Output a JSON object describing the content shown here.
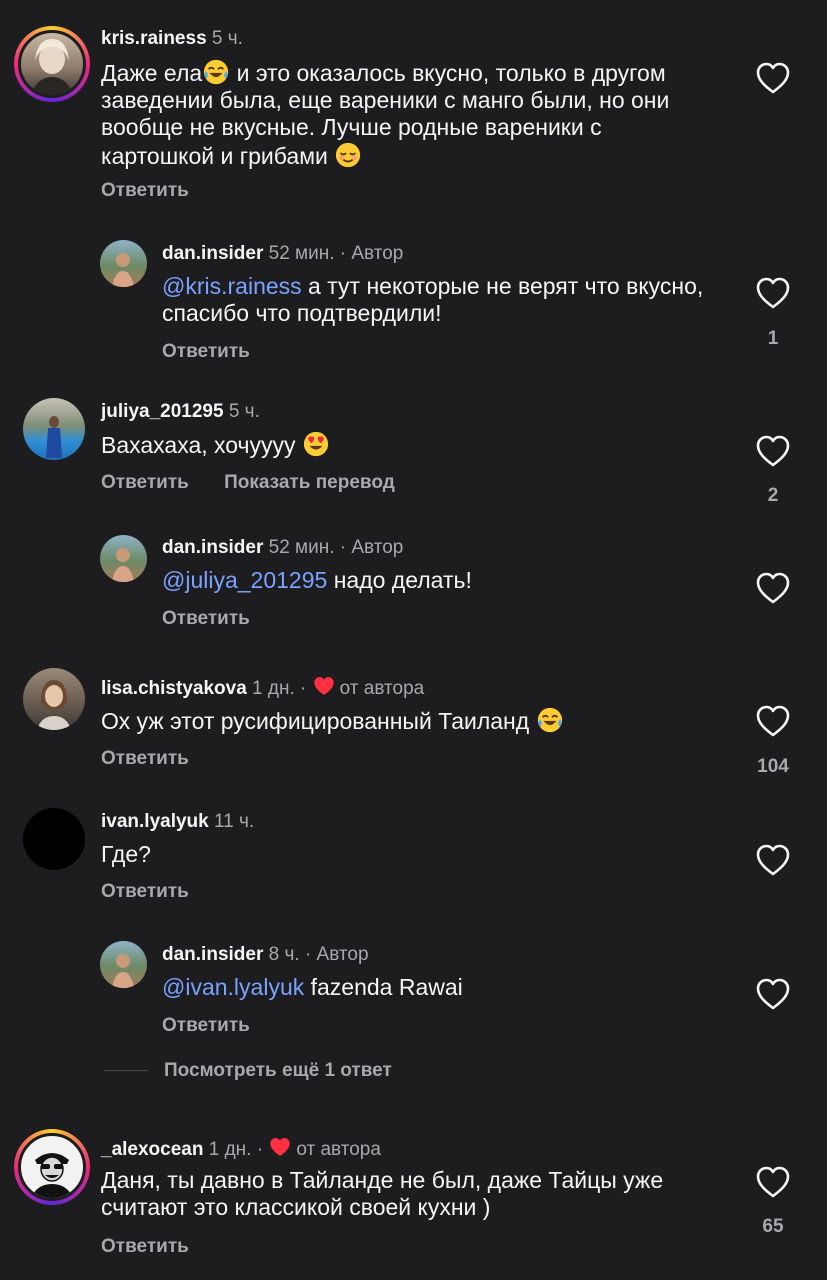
{
  "colors": {
    "background": "#1d1d1f",
    "text": "#f5f5f5",
    "muted": "#a8a8ad",
    "mention": "#7aa2ff",
    "heart": "#ff3040"
  },
  "reply_label": "Ответить",
  "c1": {
    "user": "kris.rainess",
    "time": "5 ч.",
    "text_a": "Даже ела",
    "text_b": " и это оказалось вкусно, только в другом заведении была, еще вареники с манго были, но они вообще не вкусные. Лучше родные вареники с картошкой и грибами ",
    "emoji_a": "joy-emoji",
    "emoji_b": "relieved-emoji",
    "reply": "Ответить"
  },
  "r1": {
    "user": "dan.insider",
    "time": "52 мин. · Автор",
    "mention": "@kris.rainess",
    "text": " а тут некоторые не верят что вкусно, спасибо что подтвердили!",
    "reply": "Ответить",
    "likes": "1"
  },
  "c2": {
    "user": "juliya_201295",
    "time": "5 ч.",
    "text": "Вахахаха, хочуууу ",
    "emoji": "heart-eyes-emoji",
    "reply": "Ответить",
    "translate": "Показать перевод",
    "likes": "2"
  },
  "r2": {
    "user": "dan.insider",
    "time": "52 мин. · Автор",
    "mention": "@juliya_201295",
    "text": " надо делать!",
    "reply": "Ответить"
  },
  "c3": {
    "user": "lisa.chistyakova",
    "time": "1 дн. ·",
    "liked_by_author": "от автора",
    "text": "Ох уж этот русифицированный Таиланд ",
    "emoji": "joy-emoji",
    "reply": "Ответить",
    "likes": "104"
  },
  "c4": {
    "user": "ivan.lyalyuk",
    "time": "11 ч.",
    "text": "Где?",
    "reply": "Ответить"
  },
  "r4": {
    "user": "dan.insider",
    "time": "8 ч. · Автор",
    "mention": "@ivan.lyalyuk",
    "text": " fazenda Rawai",
    "reply": "Ответить"
  },
  "view_more": "Посмотреть ещё 1 ответ",
  "c5": {
    "user": "_alexocean",
    "time": "1 дн. ·",
    "liked_by_author": "от автора",
    "text": "Даня, ты давно в Тайланде не был, даже Тайцы уже считают это классикой своей кухни )",
    "reply": "Ответить",
    "likes": "65"
  }
}
